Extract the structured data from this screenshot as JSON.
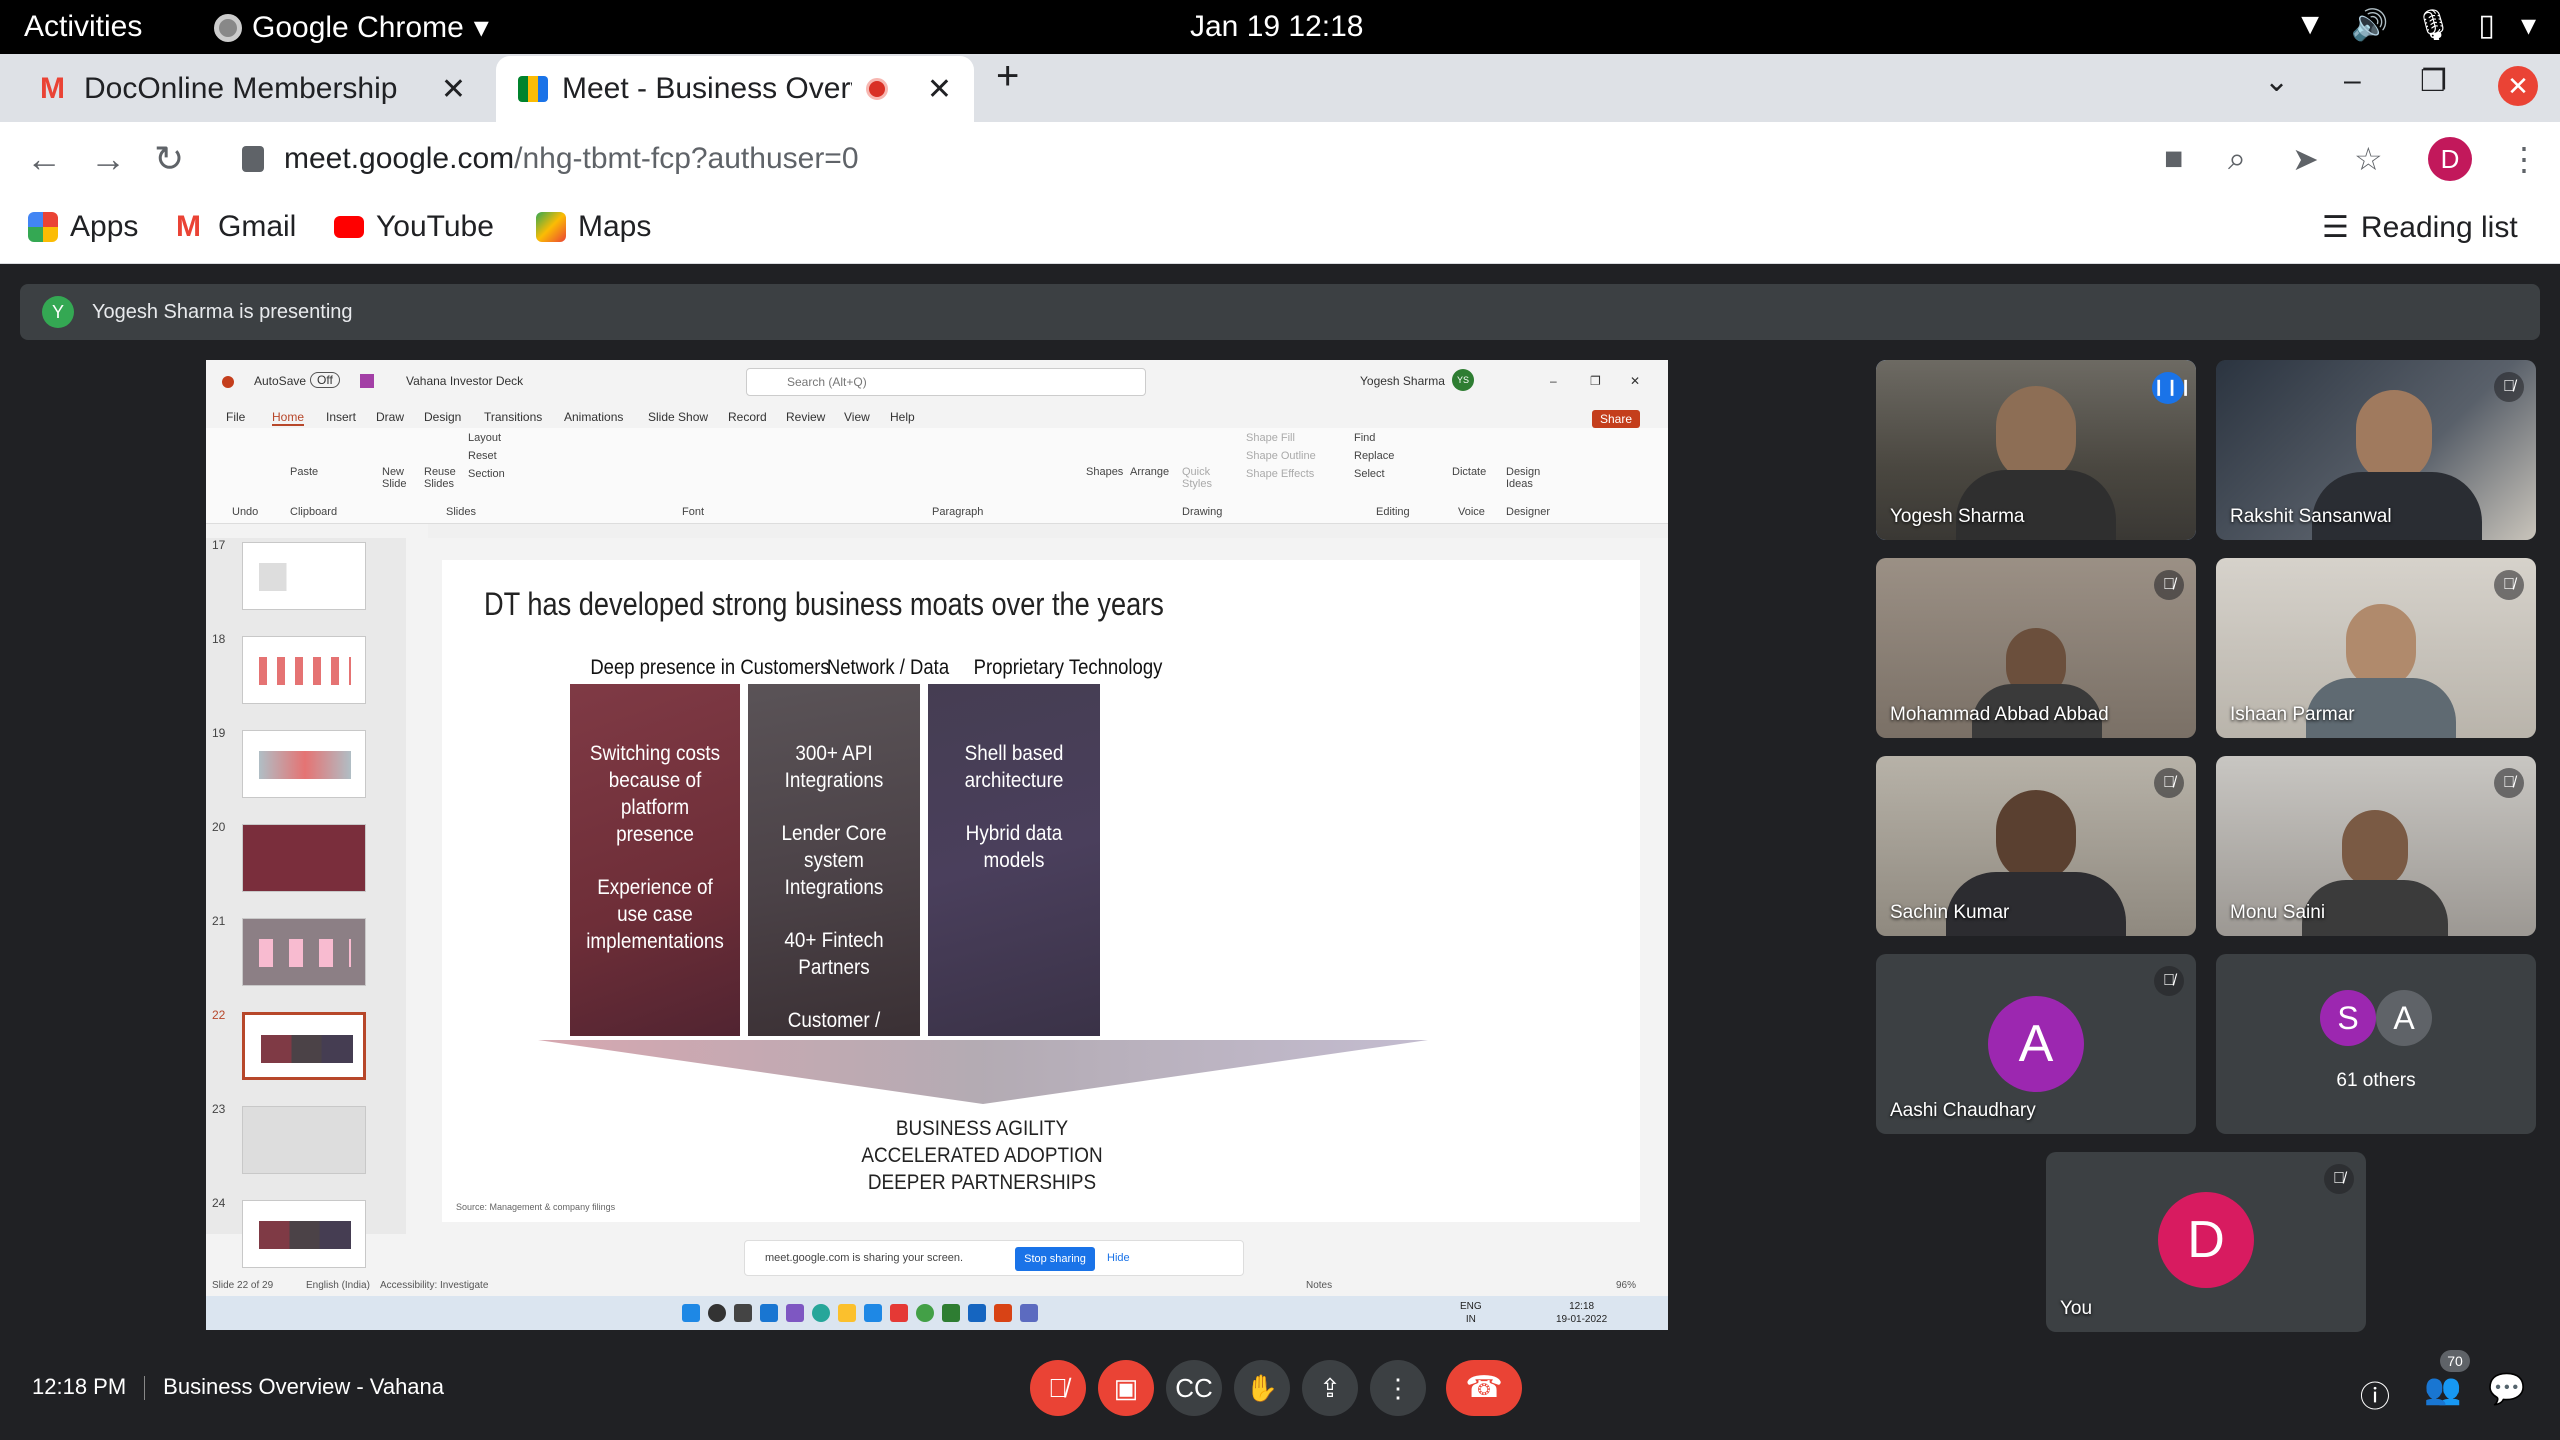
{
  "gnome": {
    "activities": "Activities",
    "app_name": "Google Chrome",
    "clock": "Jan 19  12:18"
  },
  "browser": {
    "tabs": [
      {
        "title": "DocOnline Membership - ",
        "favicon": "gmail-icon"
      },
      {
        "title": "Meet - Business Overv",
        "favicon": "meet-icon",
        "recording": true
      }
    ],
    "url_host": "meet.google.com",
    "url_path": "/nhg-tbmt-fcp?authuser=0",
    "profile_initial": "D",
    "bookmarks": [
      {
        "label": "Apps",
        "icon": "apps-grid-icon"
      },
      {
        "label": "Gmail",
        "icon": "gmail-icon"
      },
      {
        "label": "YouTube",
        "icon": "youtube-icon"
      },
      {
        "label": "Maps",
        "icon": "maps-icon"
      }
    ],
    "reading_list": "Reading list"
  },
  "meet": {
    "presenter_initial": "Y",
    "presenting_banner": "Yogesh Sharma is presenting",
    "meeting_time": "12:18 PM",
    "meeting_title": "Business Overview - Vahana",
    "people_count": "70",
    "participants": [
      {
        "name": "Yogesh Sharma",
        "speaking": true
      },
      {
        "name": "Rakshit Sansanwal",
        "muted": true
      },
      {
        "name": "Mohammad Abbad Abbad",
        "muted": true
      },
      {
        "name": "Ishaan Parmar",
        "muted": true
      },
      {
        "name": "Sachin Kumar",
        "muted": true
      },
      {
        "name": "Monu Saini",
        "muted": true
      },
      {
        "name": "Aashi Chaudhary",
        "initial": "A",
        "muted": true,
        "avatar_color": "#9c27b0"
      },
      {
        "name": "61 others",
        "initials": [
          "S",
          "A"
        ],
        "avatar_colors": [
          "#9c27b0",
          "#5f6368"
        ]
      },
      {
        "name": "You",
        "initial": "D",
        "muted": true,
        "avatar_color": "#d81b60"
      }
    ]
  },
  "shared_screen": {
    "autosave": "AutoSave",
    "autosave_state": "Off",
    "file_name": "Vahana Investor Deck",
    "search_placeholder": "Search (Alt+Q)",
    "user_name": "Yogesh Sharma",
    "user_initials": "YS",
    "menu": [
      "File",
      "Home",
      "Insert",
      "Draw",
      "Design",
      "Transitions",
      "Animations",
      "Slide Show",
      "Record",
      "Review",
      "View",
      "Help"
    ],
    "share_label": "Share",
    "ribbon": {
      "undo": "Undo",
      "paste": "Paste",
      "clipboard": "Clipboard",
      "new_slide": "New Slide",
      "reuse_slides": "Reuse Slides",
      "layout": "Layout",
      "reset": "Reset",
      "section": "Section",
      "slides": "Slides",
      "font": "Font",
      "paragraph": "Paragraph",
      "shapes": "Shapes",
      "arrange": "Arrange",
      "quick_styles": "Quick Styles",
      "shape_fill": "Shape Fill",
      "shape_outline": "Shape Outline",
      "shape_effects": "Shape Effects",
      "drawing": "Drawing",
      "find": "Find",
      "replace": "Replace",
      "select": "Select",
      "editing": "Editing",
      "dictate": "Dictate",
      "voice": "Voice",
      "design_ideas": "Design Ideas",
      "designer": "Designer"
    },
    "thumb_numbers": [
      "17",
      "18",
      "19",
      "20",
      "21",
      "22",
      "23",
      "24"
    ],
    "selected_slide": "22",
    "slide": {
      "title": "DT has developed strong business moats over the years",
      "columns": [
        {
          "heading": "Deep presence in Customers",
          "items": [
            "Switching costs because of platform presence",
            "Experience of use case implementations"
          ]
        },
        {
          "heading": "Network / Data",
          "items": [
            "300+ API Integrations",
            "Lender Core system Integrations",
            "40+ Fintech Partners",
            "Customer / Transaction data from Saarathi"
          ]
        },
        {
          "heading": "Proprietary Technology",
          "items": [
            "Shell based architecture",
            "Hybrid data models"
          ]
        }
      ],
      "outcomes": [
        "BUSINESS AGILITY",
        "ACCELERATED ADOPTION",
        "DEEPER PARTNERSHIPS"
      ],
      "source": "Source: Management & company filings"
    },
    "sharing_message": "meet.google.com is sharing your screen.",
    "stop_sharing": "Stop sharing",
    "hide": "Hide",
    "status_slide": "Slide 22 of 29",
    "status_lang": "English (India)",
    "status_accessibility": "Accessibility: Investigate",
    "status_notes": "Notes",
    "status_zoom": "96%",
    "taskbar_lang": "ENG",
    "taskbar_region": "IN",
    "taskbar_time": "12:18",
    "taskbar_date": "19-01-2022"
  }
}
